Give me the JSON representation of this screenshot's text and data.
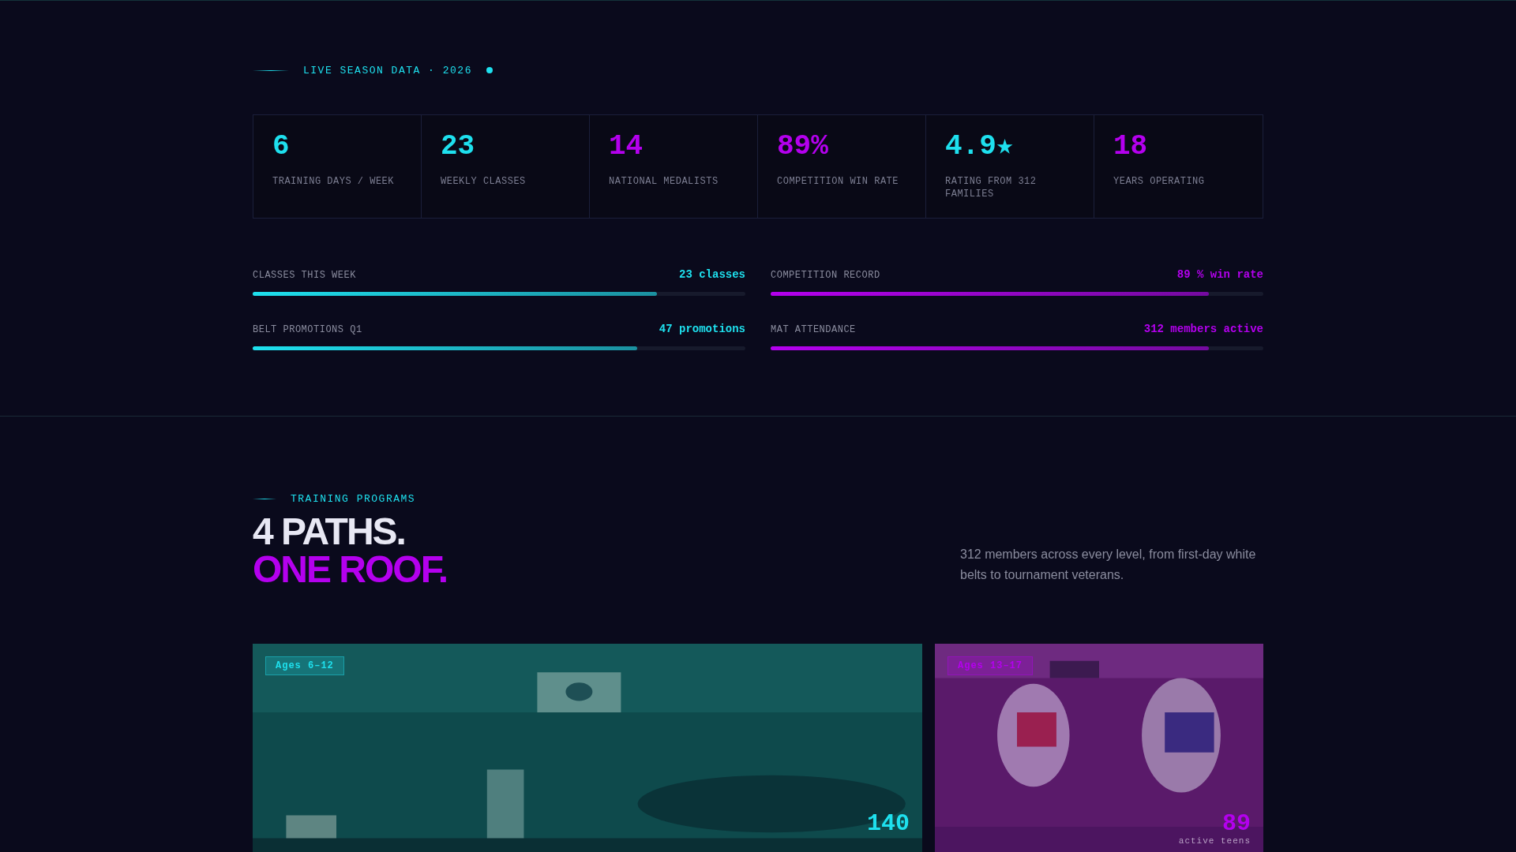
{
  "live_header": {
    "label": "LIVE SEASON DATA · 2026",
    "live": true
  },
  "stats": [
    {
      "value": "6",
      "label": "TRAINING DAYS / WEEK",
      "color": "#1ee0ee"
    },
    {
      "value": "23",
      "label": "WEEKLY CLASSES",
      "color": "#1ee0ee"
    },
    {
      "value": "14",
      "label": "NATIONAL MEDALISTS",
      "color": "#b400ee"
    },
    {
      "value": "89%",
      "label": "COMPETITION WIN RATE",
      "color": "#b400ee"
    },
    {
      "value": "4.9★",
      "label": "RATING FROM 312 FAMILIES",
      "color": "#1ee0ee"
    },
    {
      "value": "18",
      "label": "YEARS OPERATING",
      "color": "#b400ee"
    }
  ],
  "meters": [
    {
      "label": "CLASSES THIS WEEK",
      "reading": "23 classes",
      "level": 0.82,
      "color": "#1ee0ee"
    },
    {
      "label": "COMPETITION RECORD",
      "reading": "89 % win rate",
      "level": 0.89,
      "color": "#b400ee"
    },
    {
      "label": "BELT PROMOTIONS Q1",
      "reading": "47 promotions",
      "level": 0.78,
      "color": "#1ee0ee"
    },
    {
      "label": "MAT ATTENDANCE",
      "reading": "312 members active",
      "level": 0.89,
      "color": "#b400ee"
    }
  ],
  "programs": {
    "eyebrow": "TRAINING PROGRAMS",
    "title_line_1": "4 PATHS.",
    "title_line_2": "ONE ROOF.",
    "description": "312 members across every level, from first-day white belts to tournament veterans.",
    "cards": [
      {
        "kind": "picture",
        "tag": "Ages 6–12",
        "count": "140",
        "color": "#1ee0ee"
      },
      {
        "kind": "picture",
        "tag": "Ages 13–17",
        "count": "89",
        "caption": "active teens",
        "color": "#b400ee"
      }
    ]
  }
}
